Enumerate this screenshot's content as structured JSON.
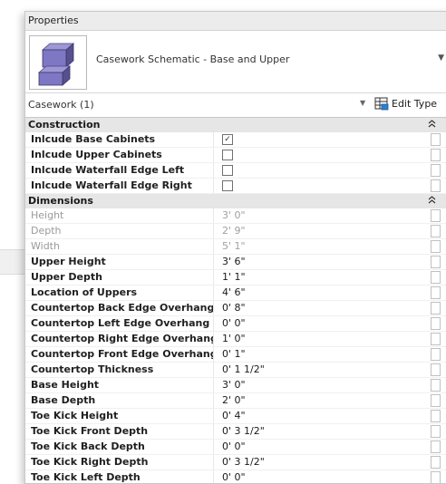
{
  "panel": {
    "title": "Properties"
  },
  "type_selector": {
    "name": "Casework Schematic - Base and Upper"
  },
  "instance_filter": {
    "label": "Casework (1)",
    "edit_type_label": "Edit Type"
  },
  "groups": [
    {
      "name": "Construction",
      "params": [
        {
          "name": "Inlcude Base Cabinets",
          "checkbox": true,
          "checked": true
        },
        {
          "name": "Inlcude Upper Cabinets",
          "checkbox": true,
          "checked": false
        },
        {
          "name": "Inlcude Waterfall Edge Left",
          "checkbox": true,
          "checked": false
        },
        {
          "name": "Inlcude Waterfall Edge Right",
          "checkbox": true,
          "checked": false
        }
      ]
    },
    {
      "name": "Dimensions",
      "params": [
        {
          "name": "Height",
          "value": "3'  0\"",
          "disabled": true
        },
        {
          "name": "Depth",
          "value": "2'  9\"",
          "disabled": true
        },
        {
          "name": "Width",
          "value": "5'  1\"",
          "disabled": true
        },
        {
          "name": "Upper Height",
          "value": "3'  6\""
        },
        {
          "name": "Upper Depth",
          "value": "1'  1\""
        },
        {
          "name": "Location of Uppers",
          "value": "4'  6\""
        },
        {
          "name": "Countertop Back Edge Overhang",
          "value": "0'  8\""
        },
        {
          "name": "Countertop Left Edge Overhang",
          "value": "0'  0\""
        },
        {
          "name": "Countertop Right Edge Overhang",
          "value": "1'  0\""
        },
        {
          "name": "Countertop Front Edge Overhang",
          "value": "0'  1\""
        },
        {
          "name": "Countertop Thickness",
          "value": "0'  1 1/2\""
        },
        {
          "name": "Base Height",
          "value": "3'  0\""
        },
        {
          "name": "Base Depth",
          "value": "2'  0\""
        },
        {
          "name": "Toe Kick Height",
          "value": "0'  4\""
        },
        {
          "name": "Toe Kick Front Depth",
          "value": "0'  3 1/2\""
        },
        {
          "name": "Toe Kick Back Depth",
          "value": "0'  0\""
        },
        {
          "name": "Toe Kick Right Depth",
          "value": "0'  3 1/2\""
        },
        {
          "name": "Toe Kick Left Depth",
          "value": "0'  0\""
        }
      ]
    }
  ],
  "icons": {
    "type_thumbnail": "casework-boxes-icon",
    "dropdown": "chevron-down-icon",
    "edit_type": "edit-type-icon",
    "collapse": "double-chevron-up-icon",
    "associate": "associate-parameter-icon"
  }
}
